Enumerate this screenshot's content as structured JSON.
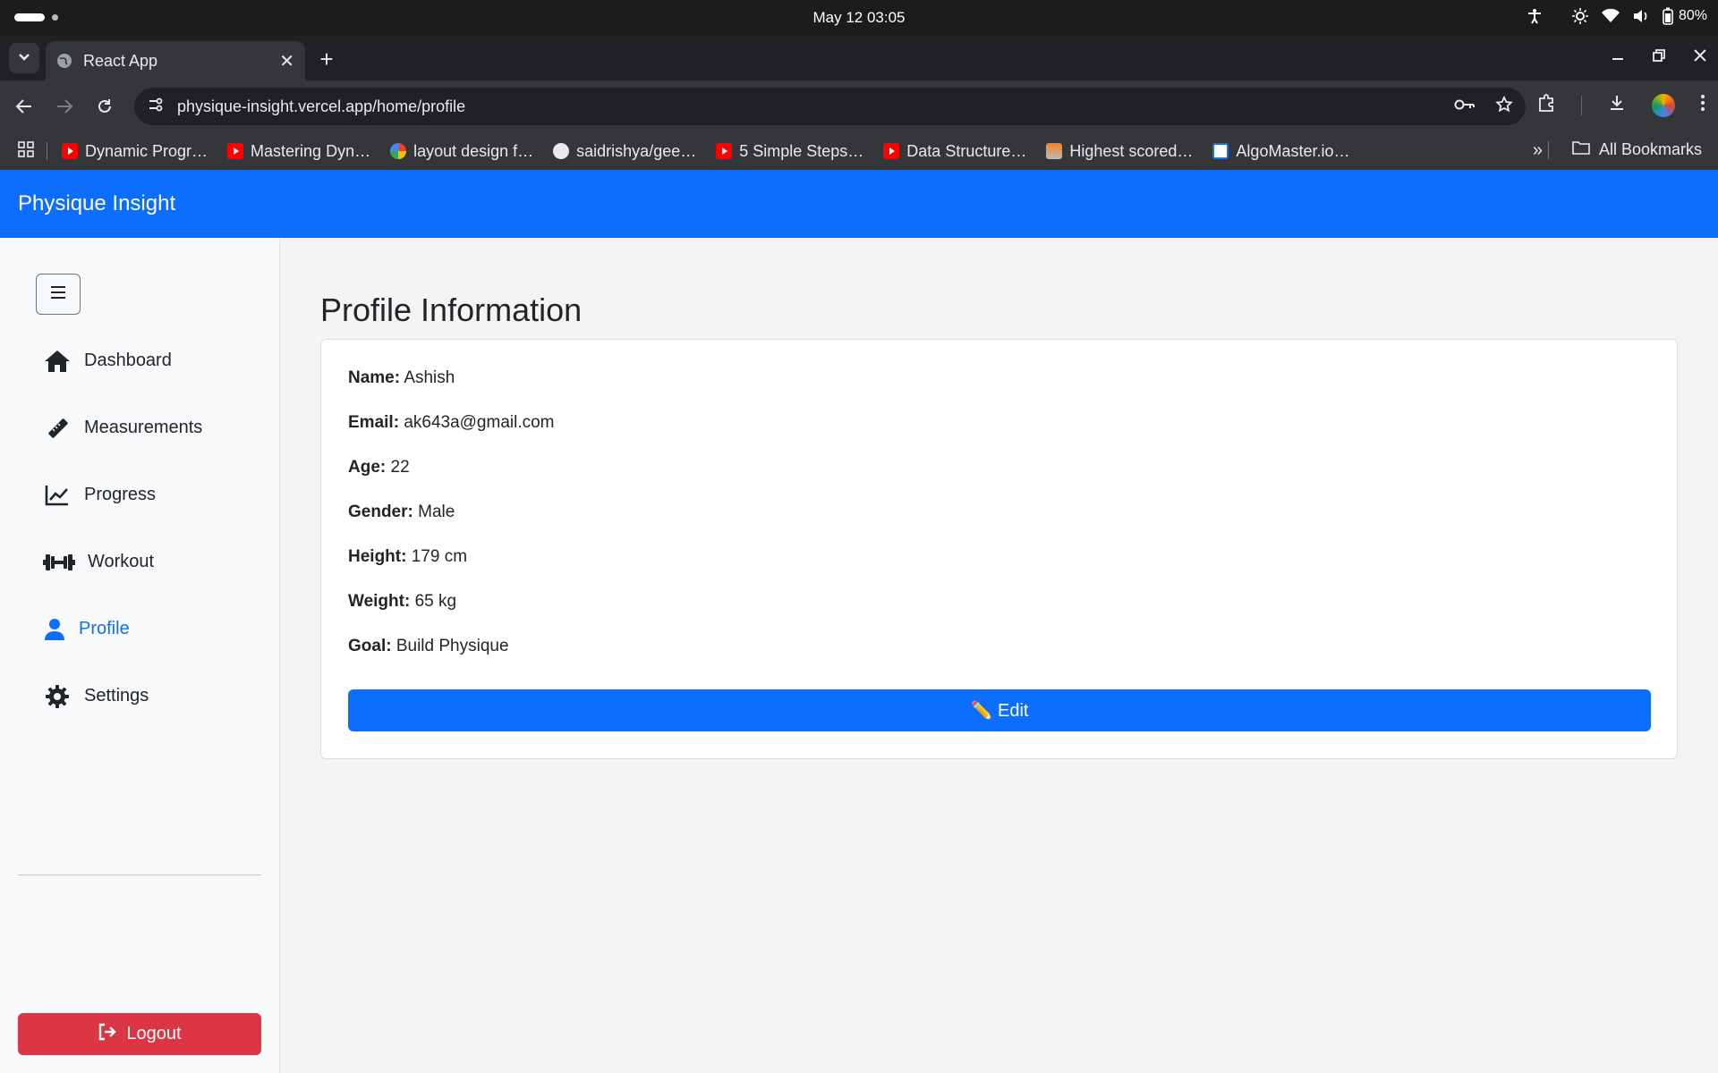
{
  "os": {
    "clock": "May 12  03:05",
    "battery": "80%"
  },
  "browser": {
    "tab_title": "React App",
    "url": "physique-insight.vercel.app/home/profile",
    "bookmarks": [
      {
        "label": "Dynamic Progr…",
        "icon": "youtube-icon"
      },
      {
        "label": "Mastering Dyn…",
        "icon": "youtube-icon"
      },
      {
        "label": "layout design f…",
        "icon": "google-icon"
      },
      {
        "label": "saidrishya/gee…",
        "icon": "github-icon"
      },
      {
        "label": "5 Simple Steps…",
        "icon": "youtube-icon"
      },
      {
        "label": "Data Structure…",
        "icon": "youtube-icon"
      },
      {
        "label": "Highest scored…",
        "icon": "stackoverflow-icon"
      },
      {
        "label": "AlgoMaster.io…",
        "icon": "algomaster-icon"
      }
    ],
    "all_bookmarks": "All Bookmarks"
  },
  "app": {
    "brand": "Physique Insight",
    "nav": [
      {
        "label": "Dashboard",
        "icon": "home-icon"
      },
      {
        "label": "Measurements",
        "icon": "ruler-icon"
      },
      {
        "label": "Progress",
        "icon": "chart-line-icon"
      },
      {
        "label": "Workout",
        "icon": "dumbbell-icon"
      },
      {
        "label": "Profile",
        "icon": "user-icon",
        "active": true
      },
      {
        "label": "Settings",
        "icon": "gear-icon"
      }
    ],
    "logout_label": "Logout"
  },
  "profile": {
    "title": "Profile Information",
    "fields": [
      {
        "label": "Name:",
        "value": "Ashish"
      },
      {
        "label": "Email:",
        "value": "ak643a@gmail.com"
      },
      {
        "label": "Age:",
        "value": "22"
      },
      {
        "label": "Gender:",
        "value": "Male"
      },
      {
        "label": "Height:",
        "value": "179 cm"
      },
      {
        "label": "Weight:",
        "value": "65 kg"
      },
      {
        "label": "Goal:",
        "value": "Build Physique"
      }
    ],
    "edit_label": "✏️ Edit"
  },
  "colors": {
    "primary": "#0d6efd",
    "danger": "#dc3545"
  }
}
